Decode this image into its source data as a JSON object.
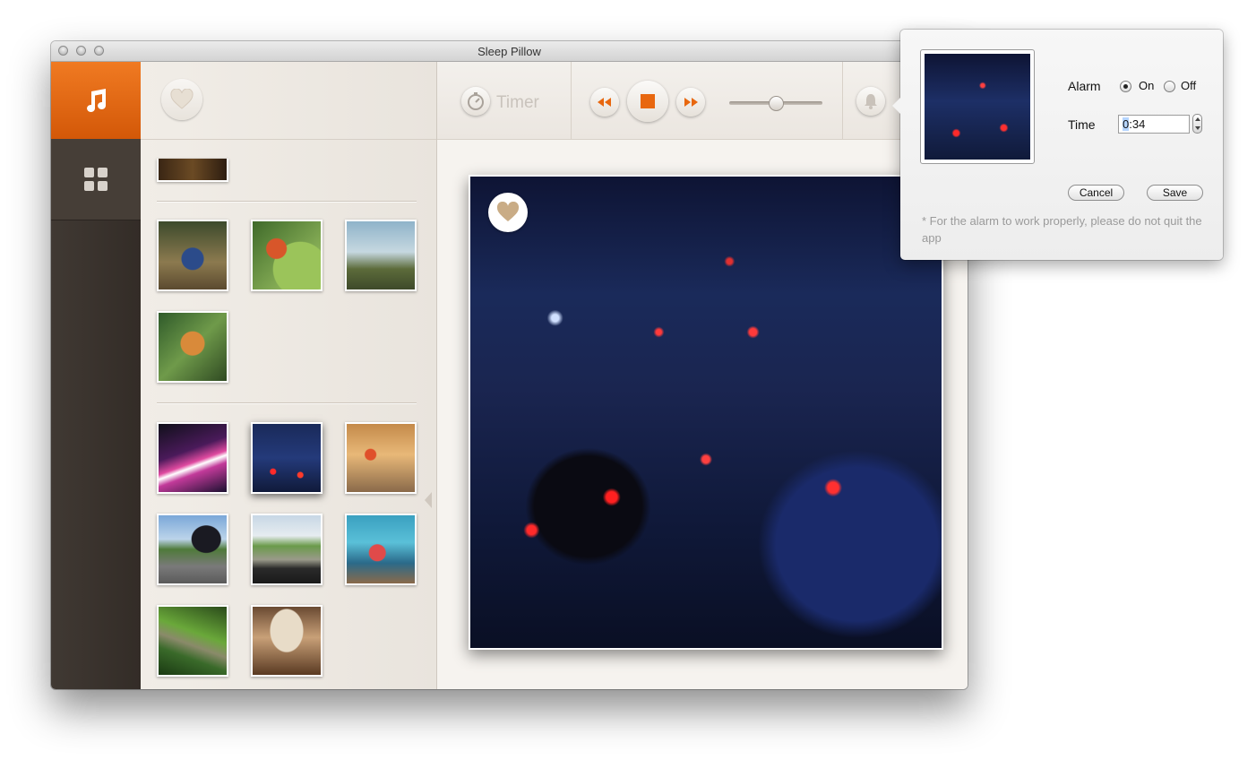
{
  "window": {
    "title": "Sleep Pillow"
  },
  "sidebar": {
    "items": [
      {
        "icon": "music-note-icon",
        "active": true
      },
      {
        "icon": "grid-icon",
        "active": false
      }
    ]
  },
  "toolbar": {
    "timer_label": "Timer",
    "volume": 0.5
  },
  "gallery": {
    "groups": [
      {
        "thumbs": [
          "partial-dark-landscape"
        ]
      },
      {
        "thumbs": [
          "blue-bird-on-rock",
          "robin-on-leaf",
          "lapwings-on-shore",
          "robin-on-branch"
        ]
      },
      {
        "thumbs": [
          "city-light-trails",
          "night-traffic",
          "scooters-in-street",
          "car-mirror-on-road",
          "country-road-from-car",
          "boat-passenger-on-lake",
          "train-in-jungle",
          "airplane-cabin"
        ]
      }
    ],
    "selected": "night-traffic"
  },
  "alarm": {
    "alarm_label": "Alarm",
    "on_label": "On",
    "off_label": "Off",
    "alarm_on": true,
    "time_label": "Time",
    "time_hours": "0",
    "time_rest": ":34",
    "cancel_label": "Cancel",
    "save_label": "Save",
    "note": "* For the alarm to work properly, please do not quit the app"
  },
  "colors": {
    "accent": "#e8670f",
    "sidebar": "#3a322c",
    "panel": "#f1ede7"
  }
}
